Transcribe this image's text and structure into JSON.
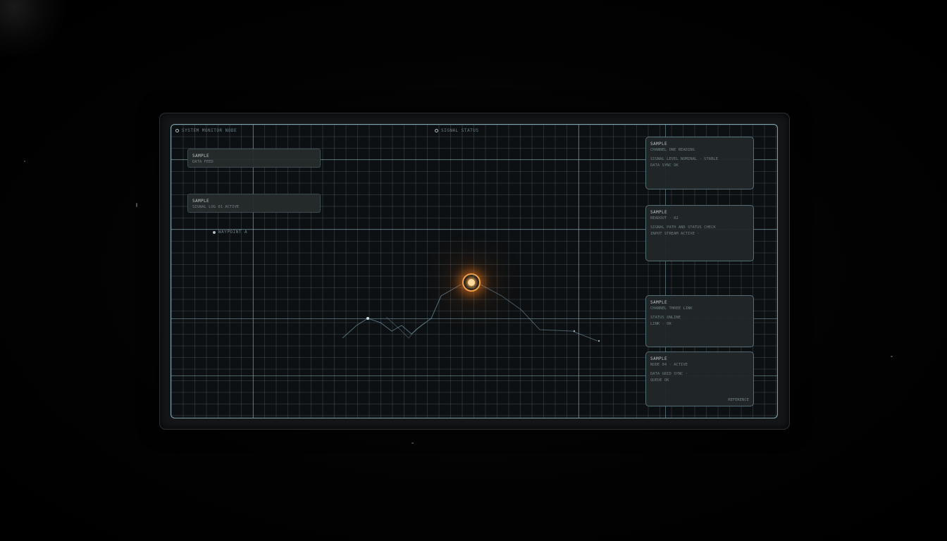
{
  "header": {
    "left_status": "SYSTEM MONITOR NODE",
    "center_status": "SIGNAL STATUS"
  },
  "left_panels": [
    {
      "title": "SAMPLE",
      "text": "DATA FEED"
    },
    {
      "title": "SAMPLE",
      "text": "SIGNAL LOG 01 ACTIVE"
    }
  ],
  "left_marker": "WAYPOINT A",
  "right_panels": [
    {
      "title": "SAMPLE",
      "line1": "CHANNEL ONE READING",
      "line2": "SIGNAL LEVEL NOMINAL · STABLE",
      "line3": "DATA SYNC OK"
    },
    {
      "title": "SAMPLE",
      "line1": "READOUT · 02",
      "line2": "SIGNAL PATH AND STATUS CHECK",
      "line3": "INPUT STREAM ACTIVE ·"
    },
    {
      "title": "SAMPLE",
      "line1": "CHANNEL THREE LINK",
      "line2": "STATUS ONLINE",
      "line3": "LINK · OK"
    },
    {
      "title": "SAMPLE",
      "line1": "NODE 04 · ACTIVE",
      "line2": "DATA GRID SYNC ·",
      "line3": "QUEUE OK",
      "footer": "REFERENCE"
    }
  ],
  "colors": {
    "accent": "#f2a04a",
    "grid_line": "#7fa3ad",
    "panel_bg": "#262b2d",
    "background": "#000000"
  },
  "icons": [
    "status-dot-icon",
    "beacon-icon"
  ]
}
